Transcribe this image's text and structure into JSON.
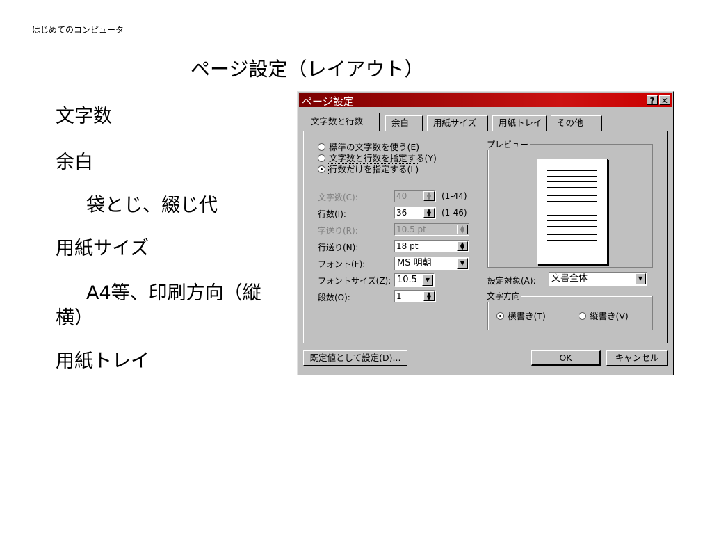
{
  "header": {
    "text": "はじめてのコンピュータ"
  },
  "slide": {
    "title": "ページ設定（レイアウト）",
    "bullets": [
      {
        "text": "文字数",
        "indent": false
      },
      {
        "text": "余白",
        "indent": false
      },
      {
        "text": "袋とじ、綴じ代",
        "indent": true
      },
      {
        "text": "用紙サイズ",
        "indent": false
      },
      {
        "text": "A4等、印刷方向（縦",
        "indent": true
      },
      {
        "text": "横）",
        "indent": false
      },
      {
        "text": "用紙トレイ",
        "indent": false
      }
    ]
  },
  "dialog": {
    "title": "ページ設定",
    "help_button": "?",
    "close_button": "✕",
    "tabs": [
      "文字数と行数",
      "余白",
      "用紙サイズ",
      "用紙トレイ",
      "その他"
    ],
    "active_tab": "文字数と行数",
    "radios": [
      {
        "label": "標準の文字数を使う(E)",
        "checked": false
      },
      {
        "label": "文字数と行数を指定する(Y)",
        "checked": false
      },
      {
        "label": "行数だけを指定する(L)",
        "checked": true
      }
    ],
    "fields": [
      {
        "label": "文字数(C):",
        "value": "40",
        "range": "(1-44)",
        "disabled": true
      },
      {
        "label": "行数(I):",
        "value": "36",
        "range": "(1-46)",
        "disabled": false
      },
      {
        "label": "字送り(R):",
        "value": "10.5 pt",
        "range": "",
        "disabled": true
      },
      {
        "label": "行送り(N):",
        "value": "18 pt",
        "range": "",
        "disabled": false
      },
      {
        "label": "フォント(F):",
        "value": "MS 明朝",
        "range": "",
        "disabled": false
      },
      {
        "label": "フォントサイズ(Z):",
        "value": "10.5",
        "range": "",
        "disabled": false
      },
      {
        "label": "段数(O):",
        "value": "1",
        "range": "",
        "disabled": false
      }
    ],
    "preview_label": "プレビュー",
    "apply_to_label": "設定対象(A):",
    "apply_to_value": "文書全体",
    "direction_label": "文字方向",
    "direction_options": [
      {
        "label": "横書き(T)",
        "checked": true
      },
      {
        "label": "縦書き(V)",
        "checked": false
      }
    ],
    "default_button": "既定値として設定(D)...",
    "ok_button": "OK",
    "cancel_button": "キャンセル"
  }
}
